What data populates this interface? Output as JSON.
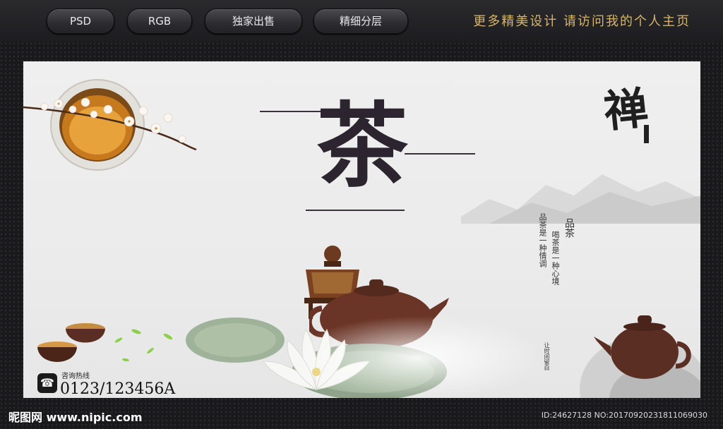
{
  "topbar": {
    "badges": [
      "PSD",
      "RGB",
      "独家出售",
      "精细分层"
    ],
    "tagline": "更多精美设计  请访问我的个人主页"
  },
  "poster": {
    "title_char": "茶",
    "chan_char": "禅",
    "pin_cha": "品茶",
    "vertical_left": "品茶是一种情调",
    "vertical_right": "喝茶是一种心境",
    "small_vertical": "让时间留白",
    "hotline_label": "咨询热线",
    "hotline_number": "0123/123456A"
  },
  "watermark": {
    "logo": "昵图网 www.nipic.com",
    "id_text": "ID:24627128 NO:20170920231811069030"
  },
  "colors": {
    "accent_gold": "#d6b56a",
    "ink": "#2c2530",
    "teapot": "#5a2e22",
    "lotus_leaf": "#9fb39a"
  }
}
